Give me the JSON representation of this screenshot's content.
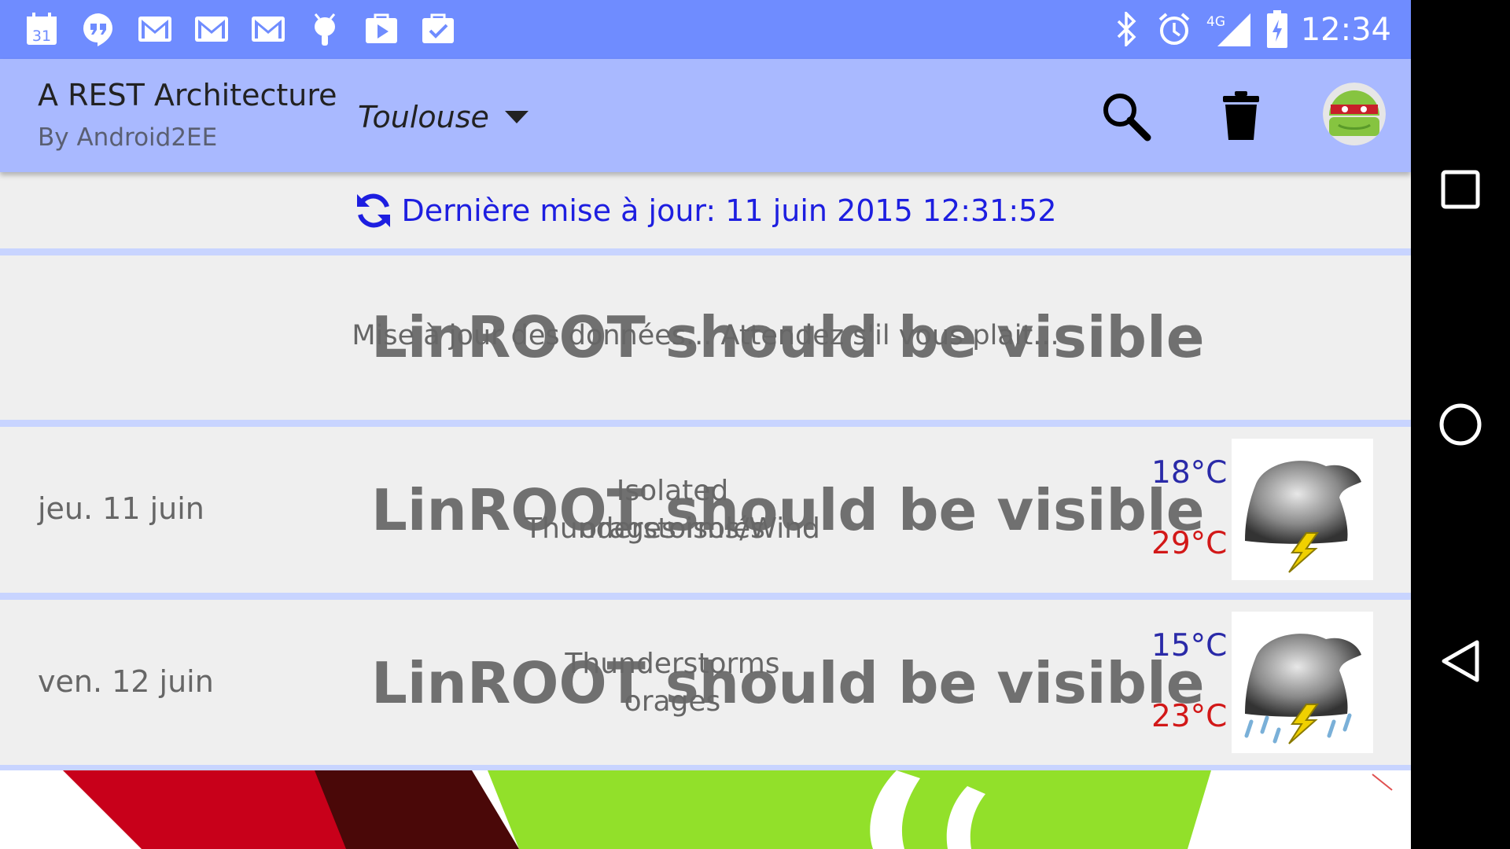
{
  "status_bar": {
    "time": "12:34",
    "left_icons": [
      "calendar-icon",
      "hangouts-icon",
      "gmail-icon",
      "gmail-icon",
      "gmail-icon",
      "android-debug-icon",
      "play-store-icon",
      "store-update-icon"
    ],
    "calendar_day": "31",
    "network_label": "4G",
    "right_icons": [
      "bluetooth-icon",
      "alarm-icon",
      "signal-icon",
      "battery-charging-icon"
    ]
  },
  "action_bar": {
    "title": "A REST Architecture",
    "subtitle": "By Android2EE",
    "city": "Toulouse",
    "actions": [
      "search-icon",
      "trash-icon",
      "avatar"
    ]
  },
  "update": {
    "text": "Dernière mise à jour: 11 juin 2015 12:31:52"
  },
  "overlay_text": "LinROOT should be visible",
  "loading": {
    "text": "Mise à jour des données... Attendez s'il vous plait..."
  },
  "forecast": [
    {
      "day": "jeu. 11 juin",
      "desc_en": "Isolated Thunderstorms/Wind",
      "desc_fr": "orages isolés",
      "tmin": "18°C",
      "tmax": "29°C",
      "icon": "thunderstorm-icon"
    },
    {
      "day": "ven. 12 juin",
      "desc_en": "Thunderstorms",
      "desc_fr": "orages",
      "tmin": "15°C",
      "tmax": "23°C",
      "icon": "thunderstorm-rain-icon"
    }
  ],
  "colors": {
    "status_bar": "#6f8cff",
    "action_bar": "#a9b9ff",
    "update_text": "#1d1ee0",
    "tmin": "#2a2aa8",
    "tmax": "#d21818"
  },
  "nav_bar": [
    "recents-icon",
    "home-icon",
    "back-icon"
  ]
}
